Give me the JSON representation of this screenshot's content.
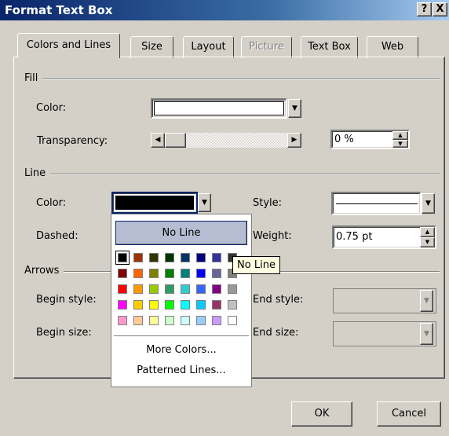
{
  "window": {
    "title": "Format Text Box",
    "help_label": "?",
    "close_label": "X"
  },
  "tabs": [
    {
      "label": "Colors and Lines"
    },
    {
      "label": "Size"
    },
    {
      "label": "Layout"
    },
    {
      "label": "Picture"
    },
    {
      "label": "Text Box"
    },
    {
      "label": "Web"
    }
  ],
  "fill": {
    "group_label": "Fill",
    "color_label": "Color:",
    "color_value": "#ffffff",
    "transparency_label": "Transparency:",
    "transparency_value": "0 %",
    "transparency_level": 0
  },
  "line": {
    "group_label": "Line",
    "color_label": "Color:",
    "color_value": "#000000",
    "dashed_label": "Dashed:",
    "style_label": "Style:",
    "weight_label": "Weight:",
    "weight_value": "0.75 pt"
  },
  "arrows": {
    "group_label": "Arrows",
    "begin_style_label": "Begin style:",
    "begin_size_label": "Begin size:",
    "end_style_label": "End style:",
    "end_size_label": "End size:"
  },
  "color_popup": {
    "no_line_label": "No Line",
    "more_colors_label": "More Colors...",
    "patterned_lines_label": "Patterned Lines...",
    "palette": [
      [
        "#000000",
        "#993300",
        "#333300",
        "#003300",
        "#003366",
        "#000080",
        "#333399",
        "#333333"
      ],
      [
        "#800000",
        "#ff6600",
        "#808000",
        "#008000",
        "#008080",
        "#0000ff",
        "#666699",
        "#808080"
      ],
      [
        "#ff0000",
        "#ff9900",
        "#99cc00",
        "#339966",
        "#33cccc",
        "#3366ff",
        "#800080",
        "#999999"
      ],
      [
        "#ff00ff",
        "#ffcc00",
        "#ffff00",
        "#00ff00",
        "#00ffff",
        "#00ccff",
        "#993366",
        "#c0c0c0"
      ],
      [
        "#ff99cc",
        "#ffcc99",
        "#ffff99",
        "#ccffcc",
        "#ccffff",
        "#99ccff",
        "#cc99ff",
        "#ffffff"
      ]
    ]
  },
  "tooltip": {
    "text": "No Line"
  },
  "buttons": {
    "ok_label": "OK",
    "cancel_label": "Cancel"
  }
}
